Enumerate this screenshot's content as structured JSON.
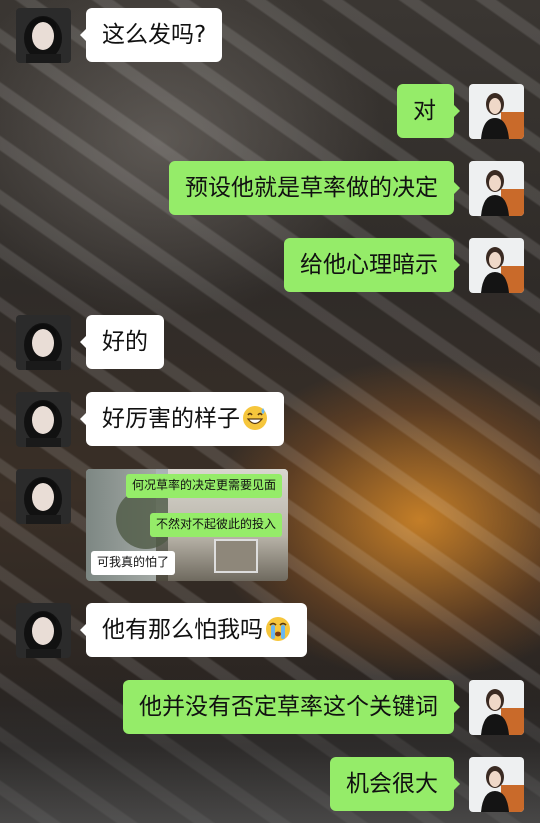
{
  "messages": [
    {
      "side": "left",
      "text": "这么发吗?"
    },
    {
      "side": "right",
      "text": "对"
    },
    {
      "side": "right",
      "text": "预设他就是草率做的决定"
    },
    {
      "side": "right",
      "text": "给他心理暗示"
    },
    {
      "side": "left",
      "text": "好的"
    },
    {
      "side": "left",
      "text": "好厉害的样子",
      "emoji": "grinning-sweat-emoji"
    },
    {
      "side": "left",
      "type": "image",
      "image_texts": [
        "何况草率的决定更需要见面",
        "不然对不起彼此的投入",
        "可我真的怕了"
      ]
    },
    {
      "side": "left",
      "text": "他有那么怕我吗",
      "emoji": "crying-emoji"
    },
    {
      "side": "right",
      "text": "他并没有否定草率这个关键词"
    },
    {
      "side": "right",
      "text": "机会很大"
    }
  ],
  "colors": {
    "bubble_self": "#95ec69",
    "bubble_other": "#ffffff"
  }
}
